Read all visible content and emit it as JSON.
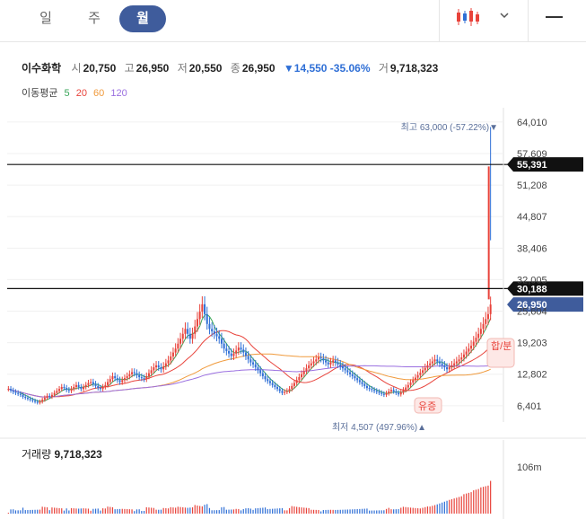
{
  "tabs": [
    {
      "label": "일"
    },
    {
      "label": "주"
    },
    {
      "label": "월",
      "active": true
    }
  ],
  "stock": {
    "name": "이수화학",
    "open_label": "시",
    "open": "20,750",
    "high_label": "고",
    "high": "26,950",
    "low_label": "저",
    "low": "20,550",
    "close_label": "종",
    "close": "26,950",
    "change": "▼14,550 -35.06%",
    "volume_label": "거",
    "volume": "9,718,323"
  },
  "ma": {
    "label": "이동평균",
    "periods": [
      {
        "label": "5",
        "color": "#3aa65a"
      },
      {
        "label": "20",
        "color": "#e8433b"
      },
      {
        "label": "60",
        "color": "#f09a3c"
      },
      {
        "label": "120",
        "color": "#9a6fe0"
      }
    ]
  },
  "volume_panel": {
    "label": "거래량",
    "value": "9,718,323",
    "axis_label": "106m"
  },
  "colors": {
    "up": "#e8433b",
    "down": "#2f6fd6",
    "accent": "#3f5c9c"
  },
  "chart_data": {
    "type": "candlestick",
    "y_ticks": [
      6401,
      12802,
      19203,
      25604,
      32005,
      38406,
      44807,
      51208,
      57609,
      64010
    ],
    "y_tick_labels": [
      "6,401",
      "12,802",
      "19,203",
      "25,604",
      "32,005",
      "38,406",
      "44,807",
      "51,208",
      "57,609",
      "64,010"
    ],
    "ylim": [
      4000,
      66000
    ],
    "horizontal_lines": [
      {
        "value": 55391,
        "label": "55,391"
      },
      {
        "value": 30188,
        "label": "30,188"
      }
    ],
    "current": {
      "value": 26950,
      "label": "26,950"
    },
    "max_annotation": "최고 63,000 (-57.22%)▼",
    "min_annotation": "최저 4,507 (497.96%)▲",
    "event_markers": [
      "합/분",
      "유증"
    ],
    "series_close": [
      9800,
      9500,
      9200,
      9000,
      8800,
      8600,
      8200,
      8000,
      7800,
      7600,
      7400,
      7200,
      7000,
      7200,
      7600,
      8000,
      8400,
      8200,
      8600,
      9000,
      9400,
      9800,
      10200,
      10000,
      9600,
      9400,
      9800,
      10200,
      10600,
      10200,
      9800,
      10200,
      10600,
      11000,
      11200,
      10800,
      10400,
      10000,
      9800,
      10200,
      10600,
      11200,
      11800,
      12400,
      12000,
      11600,
      11200,
      11600,
      12000,
      12400,
      12800,
      13200,
      13000,
      12600,
      12200,
      12000,
      11800,
      12400,
      13000,
      13600,
      14200,
      14600,
      14200,
      13800,
      14400,
      15000,
      15600,
      16400,
      17200,
      18000,
      19000,
      20000,
      21000,
      22000,
      21000,
      20000,
      21000,
      22500,
      24000,
      25500,
      27000,
      25000,
      23000,
      22000,
      21500,
      21000,
      20500,
      20000,
      19000,
      18000,
      17500,
      17000,
      16500,
      17000,
      17600,
      18200,
      17800,
      17200,
      16500,
      15800,
      15200,
      14800,
      14200,
      13600,
      13000,
      12400,
      11800,
      11400,
      11000,
      10600,
      10200,
      9800,
      9400,
      9000,
      9200,
      9400,
      9800,
      10400,
      11000,
      11600,
      12200,
      12800,
      13400,
      14000,
      14600,
      15000,
      15400,
      15800,
      16200,
      16000,
      15600,
      15200,
      14800,
      15200,
      15600,
      15200,
      14800,
      14400,
      14000,
      13600,
      13200,
      12800,
      12400,
      12000,
      11600,
      11200,
      10800,
      10400,
      10000,
      9800,
      9600,
      9400,
      9200,
      9000,
      8800,
      8600,
      8900,
      9300,
      9600,
      9300,
      9000,
      8700,
      9100,
      9600,
      10100,
      10600,
      11100,
      11600,
      12100,
      12600,
      13100,
      13600,
      14100,
      14600,
      15000,
      15400,
      15800,
      15400,
      15000,
      14600,
      14200,
      13800,
      14200,
      14600,
      15000,
      15400,
      15800,
      16200,
      16800,
      17400,
      18000,
      18600,
      19400,
      20200,
      21000,
      22000,
      23000,
      24000,
      25000,
      26950
    ]
  }
}
